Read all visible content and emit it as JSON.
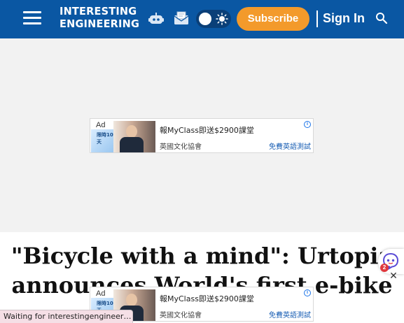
{
  "header": {
    "logo": {
      "line1": "INTERESTING",
      "line2": "ENGINEERING"
    },
    "menu_icon": "hamburger-menu-icon",
    "robot_icon": "robot-icon",
    "mail_icon": "mail-icon",
    "theme_toggle": {
      "icon": "sun-icon",
      "mode": "light"
    },
    "subscribe_label": "Subscribe",
    "signin_label": "Sign In",
    "search_icon": "search-icon",
    "colors": {
      "bar": "#0a57a3",
      "subscribe": "#f39a2b"
    }
  },
  "ads": [
    {
      "label": "Ad",
      "title": "報MyClass即送$2900課堂",
      "company": "英國文化協會",
      "cta": "免費英語測試",
      "badge": "限時10天",
      "info_icon": "info-icon"
    },
    {
      "label": "Ad",
      "title": "報MyClass即送$2900課堂",
      "company": "英國文化協會",
      "cta": "免費英語測試",
      "badge": "限時10天",
      "info_icon": "info-icon"
    }
  ],
  "article": {
    "headline_line1": "\"Bicycle with a mind\": Urtopia",
    "headline_line2": "announces World's first e-bike"
  },
  "widget": {
    "icon": "chat-bot-icon",
    "count": "2",
    "close_icon": "close-icon"
  },
  "status_bar": {
    "text": "Waiting for interestingengineeri..."
  }
}
